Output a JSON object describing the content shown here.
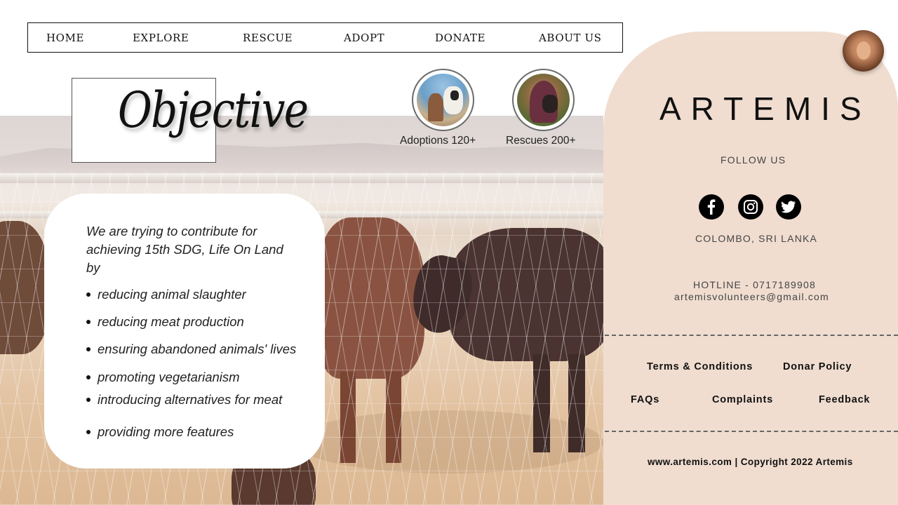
{
  "nav": {
    "items": [
      {
        "label": "HOME"
      },
      {
        "label": "EXPLORE"
      },
      {
        "label": "RESCUE"
      },
      {
        "label": "ADOPT"
      },
      {
        "label": "DONATE"
      },
      {
        "label": "ABOUT US"
      }
    ]
  },
  "objective": {
    "title": "Objective",
    "intro": "We are trying to contribute for achieving 15th SDG, Life On Land by",
    "points": [
      "reducing animal slaughter",
      "reducing meat production",
      "ensuring abandoned animals' lives",
      "promoting vegetarianism",
      "introducing alternatives for meat",
      "providing more features"
    ]
  },
  "stats": [
    {
      "label": "Adoptions 120+",
      "icon": "adoption-photo"
    },
    {
      "label": "Rescues 200+",
      "icon": "rescue-photo"
    }
  ],
  "sidebar": {
    "brand": "ARTEMIS",
    "follow_label": "FOLLOW US",
    "social": [
      {
        "name": "facebook-icon"
      },
      {
        "name": "instagram-icon"
      },
      {
        "name": "twitter-icon"
      }
    ],
    "location": "COLOMBO, SRI LANKA",
    "hotline": "HOTLINE - 0717189908",
    "email": "artemisvolunteers@gmail.com",
    "links": [
      {
        "label": "Terms & Conditions"
      },
      {
        "label": "Donar Policy"
      },
      {
        "label": "FAQs"
      },
      {
        "label": "Complaints"
      },
      {
        "label": "Feedback"
      }
    ],
    "copyright": "www.artemis.com | Copyright 2022 Artemis",
    "panel_color": "#f0ddd0"
  }
}
